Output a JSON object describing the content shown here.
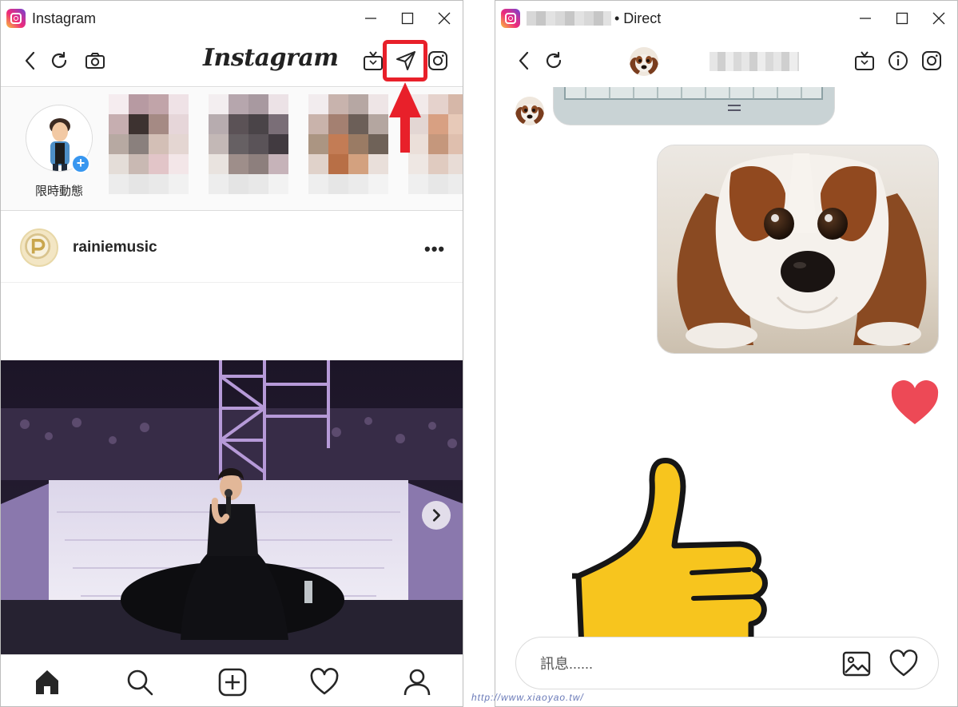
{
  "left_window": {
    "title": "Instagram",
    "brand_logo": "Instagram",
    "my_story_label": "限時動態",
    "post": {
      "username": "rainiemusic",
      "more_label": "•••"
    },
    "icons": {
      "back": "chevron-left-icon",
      "refresh": "refresh-icon",
      "camera": "camera-icon",
      "igtv": "igtv-icon",
      "direct": "paper-plane-icon",
      "profile_cam": "instagram-glyph-icon"
    },
    "tabs": [
      "home",
      "search",
      "new-post",
      "activity",
      "profile"
    ]
  },
  "right_window": {
    "title_suffix": "• Direct",
    "composer": {
      "placeholder": "訊息......"
    },
    "icons": {
      "igtv": "igtv-icon",
      "info": "info-icon",
      "profile_cam": "instagram-glyph-icon",
      "image": "image-icon",
      "like": "heart-icon"
    }
  },
  "watermark": "http://www.xiaoyao.tw/",
  "colors": {
    "highlight": "#e8202a",
    "heart": "#ed4956",
    "badge": "#3897f0"
  }
}
